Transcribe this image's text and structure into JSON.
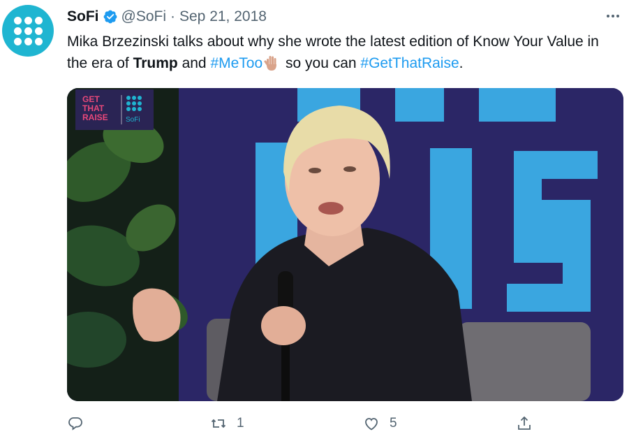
{
  "tweet": {
    "author_name": "SoFi",
    "handle": "@SoFi",
    "separator": "·",
    "date": "Sep 21, 2018",
    "text_parts": {
      "p1": "Mika Brzezinski talks about why she wrote the latest edition of Know Your Value in the era of ",
      "bold": "Trump",
      "p2": " and ",
      "hashtag1": "#MeToo",
      "p3": " so you can ",
      "hashtag2": "#GetThatRaise",
      "p4": "."
    },
    "media": {
      "logo_line1": "GET",
      "logo_line2": "THAT",
      "logo_line3": "RAISE",
      "logo_brand": "SoFi"
    },
    "actions": {
      "reply_count": "",
      "retweet_count": "1",
      "like_count": "5",
      "share_count": ""
    }
  },
  "colors": {
    "link": "#1d9bf0",
    "secondary_text": "#536471",
    "avatar_bg": "#1fb5d1",
    "logo_pink": "#e8487a"
  },
  "icons": [
    "avatar-logo",
    "verified-badge-icon",
    "more-options-icon",
    "raised-hand-emoji",
    "reply-icon",
    "retweet-icon",
    "like-icon",
    "share-icon"
  ]
}
